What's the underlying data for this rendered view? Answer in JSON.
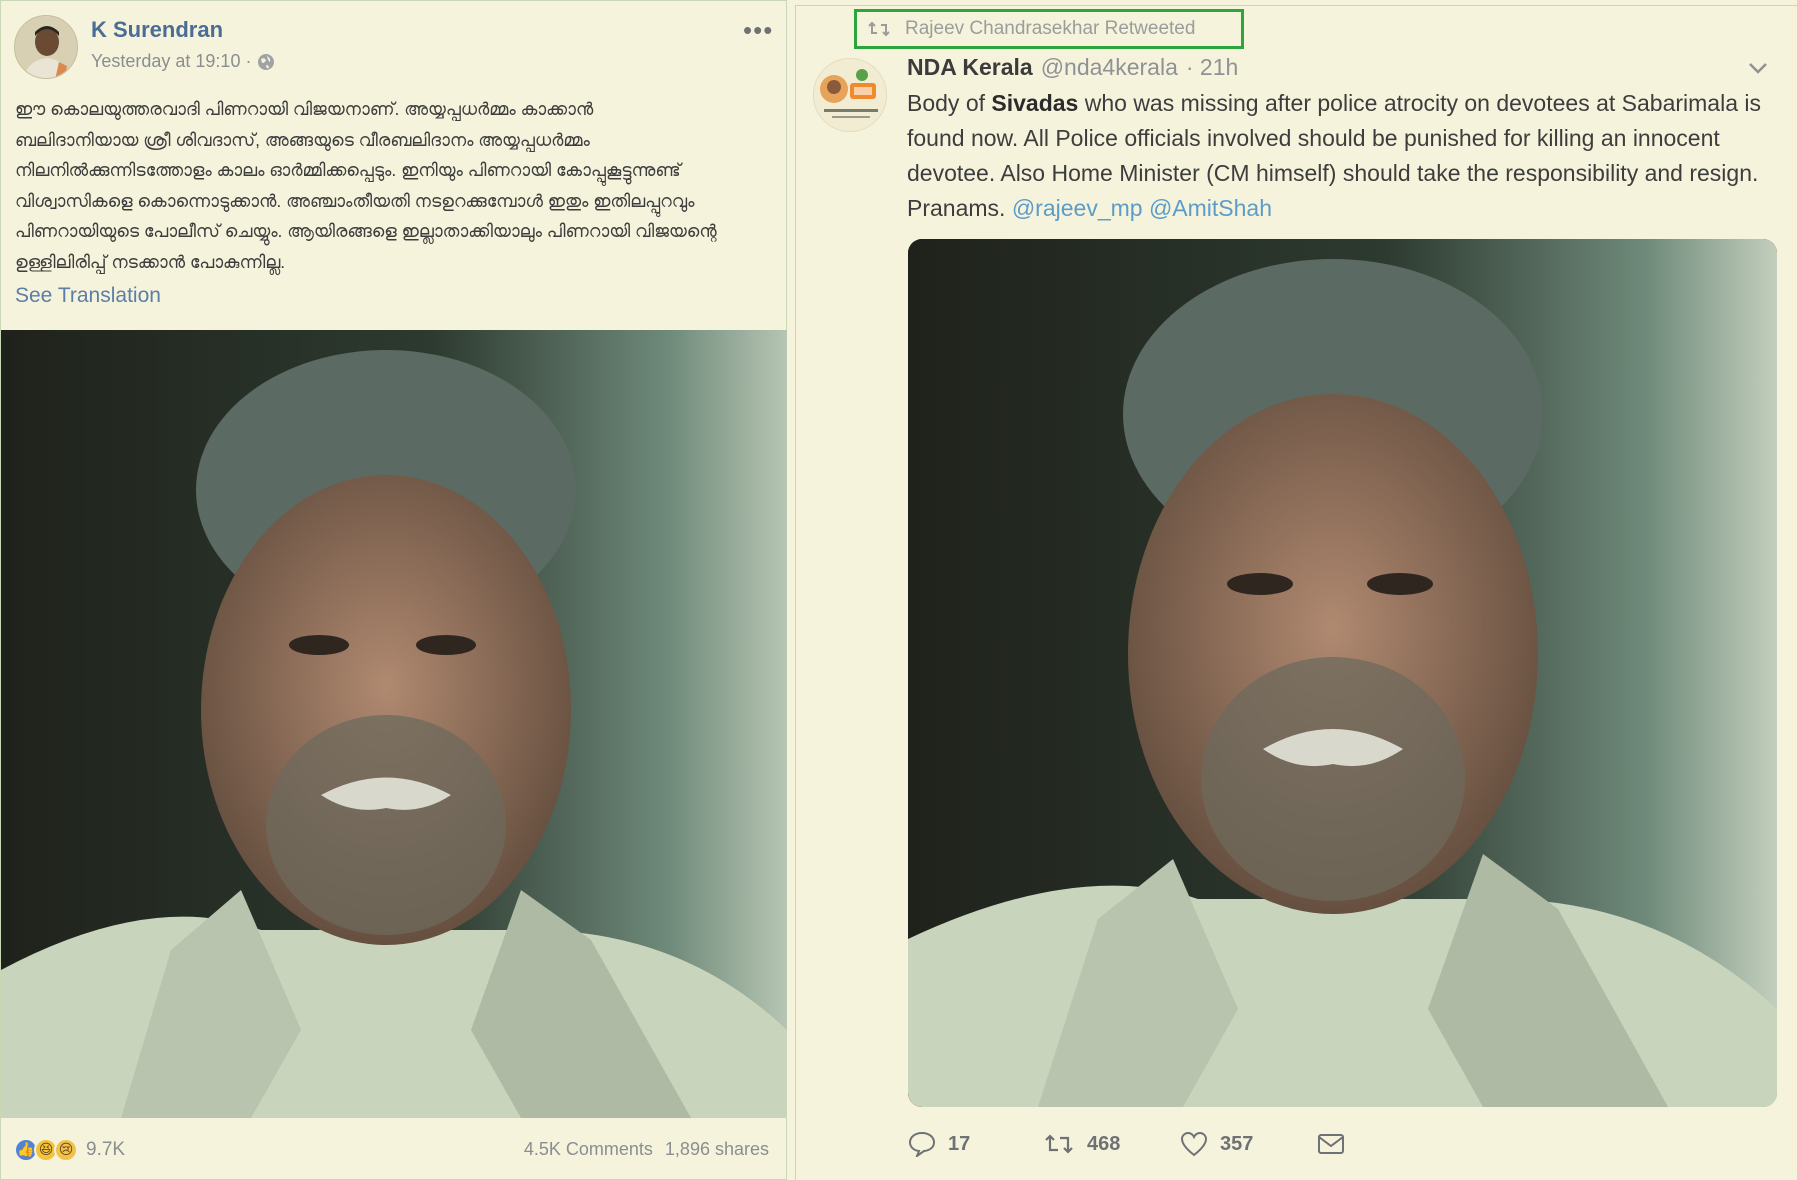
{
  "facebook": {
    "author": "K Surendran",
    "timestamp": "Yesterday at 19:10 ·",
    "more_icon": "ellipsis-icon",
    "post_text": "ഈ കൊലയുത്തരവാദി പിണറായി വിജയനാണ്. അയ്യപ്പധർമ്മം കാക്കാൻ\nബലിദാനിയായ ശ്രീ ശിവദാസ്, അങ്ങയുടെ വീരബലിദാനം അയ്യപ്പധർമ്മം\nനിലനിൽക്കുന്നിടത്തോളം കാലം ഓർമ്മിക്കപ്പെടും. ഇനിയും പിണറായി കോപ്പുകൂട്ടുന്നുണ്ട്\nവിശ്വാസികളെ കൊന്നൊടുക്കാൻ. അഞ്ചാംതീയതി നടഉറക്കുമ്പോൾ ഇതും ഇതിലപ്പുറവും\nപിണറായിയുടെ പോലീസ് ചെയ്യും. ആയിരങ്ങളെ ഇല്ലാതാക്കിയാലും പിണറായി വിജയന്റെ\nഉള്ളിലിരിപ്പ് നടക്കാൻ പോകുന്നില്ല.",
    "see_translation": "See Translation",
    "reaction_count": "9.7K",
    "comments": "4.5K Comments",
    "shares": "1,896 shares"
  },
  "twitter": {
    "retweeted_by": "Rajeev Chandrasekhar Retweeted",
    "name": "NDA Kerala",
    "handle": "@nda4kerala",
    "time": "· 21h",
    "text_before": "Body of ",
    "text_bold": "Sivadas",
    "text_after": " who was missing after police atrocity on devotees at Sabarimala is found now. All Police officials involved should be punished for killing an innocent devotee. Also Home Minister (CM himself) should take the responsibility and resign. Pranams. ",
    "mention1": "@rajeev_mp",
    "mention2": "@AmitShah",
    "replies": "17",
    "retweets": "468",
    "likes": "357"
  },
  "colors": {
    "background": "#f5f3dc",
    "fb_name": "#4b6c94",
    "link": "#5c9cc9",
    "highlight_box": "#2aa63d"
  }
}
